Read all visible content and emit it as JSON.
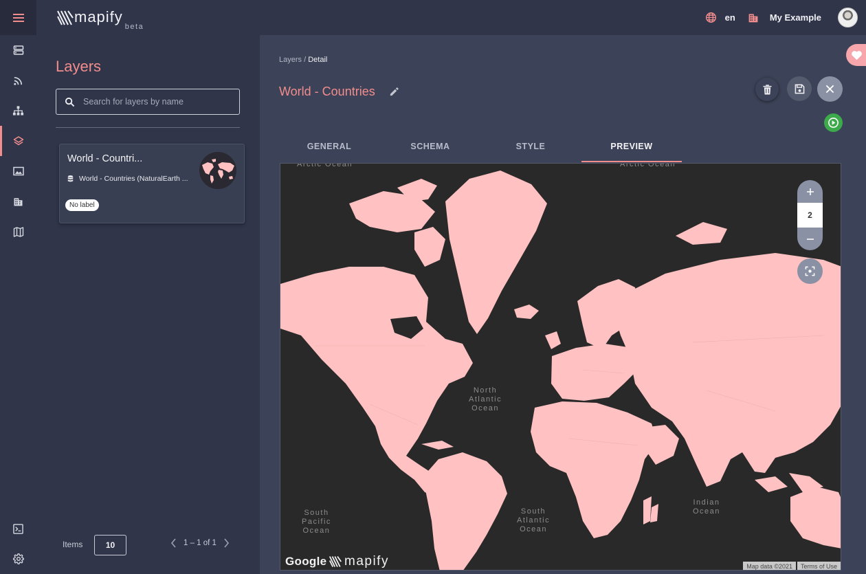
{
  "app": {
    "logo_text": "mapify",
    "logo_beta": "beta"
  },
  "header": {
    "language": "en",
    "organization": "My Example"
  },
  "sidebar": {
    "items": [
      {
        "icon": "storage-icon"
      },
      {
        "icon": "feed-icon"
      },
      {
        "icon": "hierarchy-icon"
      },
      {
        "icon": "layers-icon",
        "active": true
      },
      {
        "icon": "image-icon"
      },
      {
        "icon": "building-icon"
      },
      {
        "icon": "map-icon"
      },
      {
        "icon": "terminal-icon"
      },
      {
        "icon": "gear-icon"
      }
    ]
  },
  "layers_panel": {
    "title": "Layers",
    "search_placeholder": "Search for layers by name",
    "cards": [
      {
        "title": "World - Countri...",
        "source": "World - Countries (NaturalEarth ...",
        "label": "No label"
      }
    ],
    "items_label": "Items",
    "items_per_page": "10",
    "page_range": "1 – 1 of 1"
  },
  "detail": {
    "breadcrumb_root": "Layers",
    "breadcrumb_sep": " / ",
    "breadcrumb_current": "Detail",
    "title": "World - Countries",
    "tabs": [
      "GENERAL",
      "SCHEMA",
      "STYLE",
      "PREVIEW"
    ],
    "active_tab": "PREVIEW"
  },
  "map": {
    "zoom_level": "2",
    "ocean_labels": {
      "north_atlantic": "North\nAtlantic\nOcean",
      "south_atlantic": "South\nAtlantic\nOcean",
      "south_pacific": "South\nPacific\nOcean",
      "indian": "Indian\nOcean",
      "arctic_left": "Arctic Ocean",
      "arctic_right": "Arctic Ocean"
    },
    "google_text": "Google",
    "logo_text": "mapify",
    "attribution": "Map data ©2021",
    "terms": "Terms of Use",
    "land_color": "#ffc1c1",
    "ocean_color": "#292929"
  },
  "colors": {
    "accent": "#f28d8d",
    "background": "#3c4257",
    "panel": "#30354a",
    "play": "#3dab4b"
  }
}
